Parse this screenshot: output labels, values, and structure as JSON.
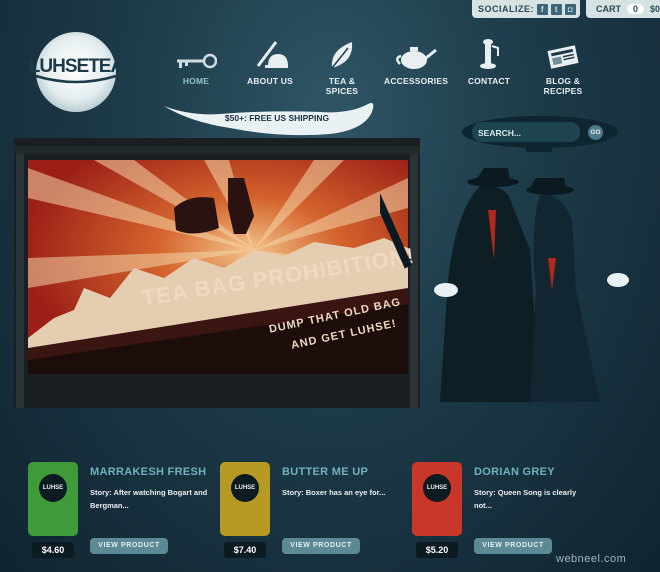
{
  "header": {
    "socialize_label": "SOCIALIZE:",
    "social_icons": [
      "facebook-icon",
      "twitter-icon",
      "instagram-icon"
    ],
    "cart_label": "CART",
    "cart_count": "0",
    "cart_total": "$0"
  },
  "logo": {
    "text": "LUHSETEA"
  },
  "nav": {
    "items": [
      {
        "label": "HOME",
        "icon": "key-icon"
      },
      {
        "label": "ABOUT US",
        "icon": "pen-bell-icon"
      },
      {
        "label": "TEA & SPICES",
        "icon": "leaf-icon"
      },
      {
        "label": "ACCESSORIES",
        "icon": "teapot-icon"
      },
      {
        "label": "CONTACT",
        "icon": "telephone-icon"
      },
      {
        "label": "BLOG & RECIPES",
        "icon": "newspaper-icon"
      }
    ],
    "active_index": 0
  },
  "shipping": {
    "text": "$50+: FREE US SHIPPING"
  },
  "search": {
    "placeholder": "SEARCH...",
    "go_label": "GO"
  },
  "banner": {
    "title": "TEA BAG PROHIBITION!",
    "sub1": "DUMP THAT OLD BAG",
    "sub2": "AND GET LUHSE!"
  },
  "products": [
    {
      "name": "MARRAKESH FRESH",
      "story": "Story: After watching Bogart and Bergman...",
      "price": "$4.60",
      "button": "VIEW PRODUCT",
      "color": "#3f9a3a"
    },
    {
      "name": "BUTTER ME UP",
      "story": "Story: Boxer has an eye for...",
      "price": "$7.40",
      "button": "VIEW PRODUCT",
      "color": "#b79a23"
    },
    {
      "name": "DORIAN GREY",
      "story": "Story: Queen Song is clearly not...",
      "price": "$5.20",
      "button": "VIEW PRODUCT",
      "color": "#c8372a"
    }
  ],
  "watermark": "webneel.com",
  "colors": {
    "background": "#1d3a48",
    "accent": "#6fb2bd",
    "poster_red": "#b3281e",
    "button": "#5b8a95"
  }
}
